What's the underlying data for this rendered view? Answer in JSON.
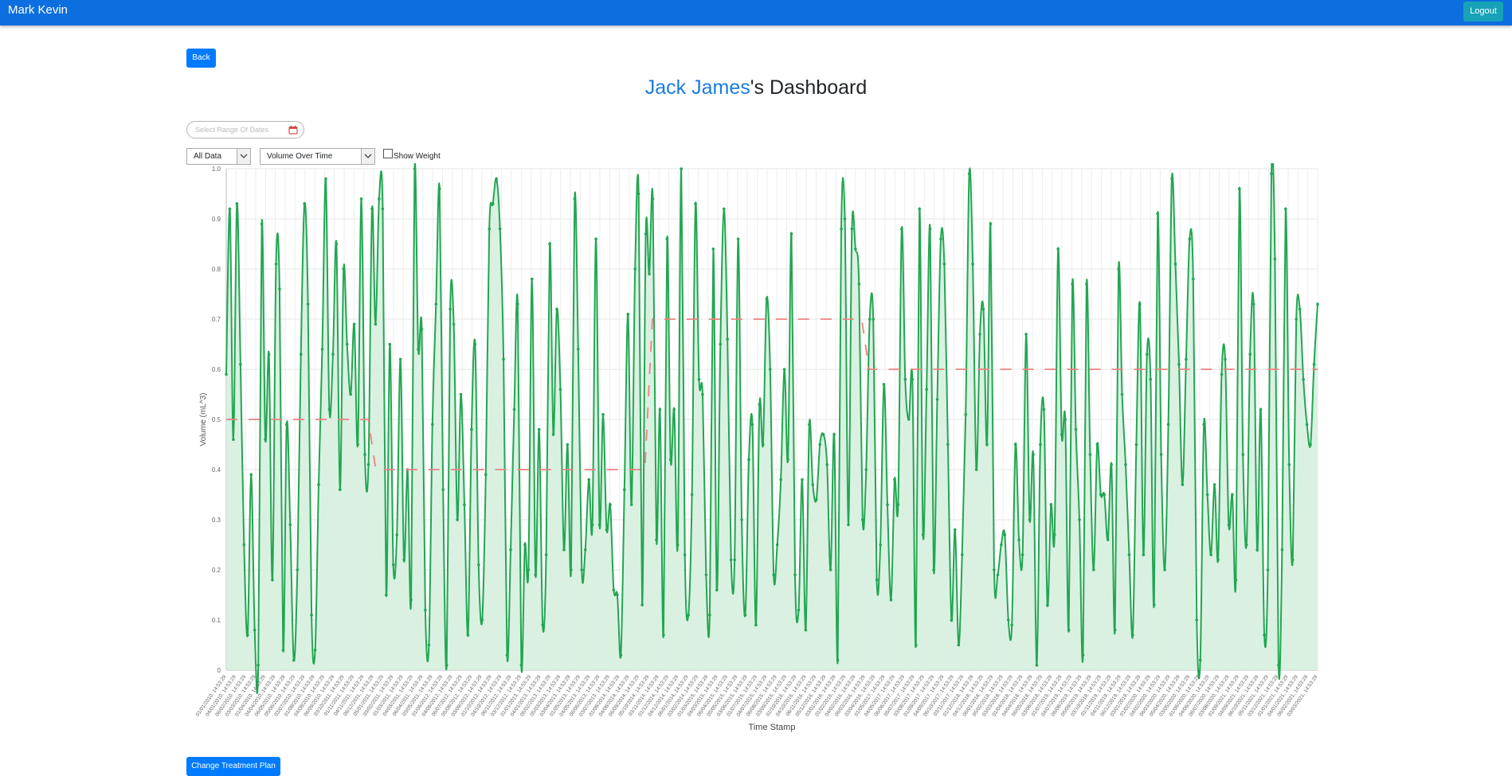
{
  "navbar": {
    "brand": "Mark Kevin",
    "logout_label": "Logout"
  },
  "back_label": "Back",
  "title": {
    "patient_name": "Jack James",
    "suffix": "'s Dashboard"
  },
  "date_range": {
    "placeholder": "Select Range Of Dates"
  },
  "filters": {
    "data_select": "All Data",
    "metric_select": "Volume Over Time",
    "show_weight_label": "Show Weight",
    "show_weight_checked": false
  },
  "change_plan_label": "Change Treatment Plan",
  "colors": {
    "navbar": "#0d6edf",
    "line": "#22a652",
    "fill": "#d6f0df",
    "target": "#f08080",
    "button": "#007bff"
  },
  "icons": {
    "calendar": "calendar-icon",
    "dropdown": "chevron-down-icon"
  },
  "chart_data": {
    "type": "area",
    "xlabel": "Time Stamp",
    "ylabel": "Volume (mL^3)",
    "ylim": [
      0,
      1
    ],
    "yticks": [
      "0",
      "0.1",
      "0.2",
      "0.3",
      "0.4",
      "0.5",
      "0.6",
      "0.7",
      "0.8",
      "0.9",
      "1.0"
    ],
    "grid": true,
    "x": [
      "01/01/2010, 14:53:29",
      "04/01/2010, 14:53:29",
      "06/02/2010, 14:53:29",
      "03/03/2010, 14:53:29",
      "01/04/2010, 14:53:29",
      "04/04/2010, 14:53:29",
      "06/05/2010, 14:53:29",
      "05/06/2010, 14:53:29",
      "03/07/2010, 14:53:29",
      "01/08/2010, 14:53:29",
      "04/08/2010, 14:53:29",
      "06/09/2010, 14:53:29",
      "03/10/2011, 14:53:29",
      "01/11/2011, 14:53:29",
      "04/11/2011, 14:53:29",
      "06/12/2011, 14:53:29",
      "05/01/2011, 14:53:29",
      "03/02/2011, 14:53:29",
      "01/03/2011, 14:53:29",
      "04/03/2011, 14:53:29",
      "06/04/2011, 14:53:29",
      "03/05/2011, 14:53:29",
      "01/06/2012, 14:53:29",
      "04/06/2012, 14:53:29",
      "06/07/2012, 14:53:29",
      "05/08/2012, 14:53:29",
      "03/09/2012, 14:53:29",
      "01/10/2012, 14:53:29",
      "04/10/2012, 14:53:29",
      "06/11/2012, 14:53:29",
      "03/12/2012, 14:53:29",
      "01/01/2013, 14:53:29",
      "04/01/2013, 14:53:29",
      "06/02/2013, 14:53:29",
      "05/03/2013, 14:53:29",
      "03/04/2013, 14:53:29",
      "01/05/2013, 14:53:29",
      "04/05/2013, 14:53:29",
      "06/06/2013, 14:53:29",
      "03/07/2013, 14:53:29",
      "01/08/2014, 14:53:29",
      "04/08/2014, 14:53:29",
      "06/09/2014, 14:53:29",
      "05/10/2014, 14:53:29",
      "03/11/2014, 14:53:29",
      "01/12/2014, 14:53:29",
      "04/12/2014, 14:53:29",
      "06/01/2014, 14:53:29",
      "03/02/2014, 14:53:29",
      "01/03/2015, 14:53:29",
      "04/03/2015, 14:53:29",
      "06/04/2015, 14:53:29",
      "05/05/2015, 14:53:29",
      "03/06/2015, 14:53:29",
      "01/07/2015, 14:53:29",
      "04/07/2015, 14:53:29",
      "06/08/2015, 14:53:29",
      "03/09/2015, 14:53:29",
      "01/10/2016, 14:53:29",
      "04/10/2016, 14:53:29",
      "06/11/2016, 14:53:29",
      "05/12/2016, 14:53:29",
      "03/01/2016, 14:53:29",
      "01/02/2016, 14:53:29",
      "04/02/2016, 14:53:29",
      "06/03/2016, 14:53:29",
      "03/04/2016, 14:53:29",
      "01/05/2017, 14:53:29",
      "04/05/2017, 14:53:29",
      "06/06/2017, 14:53:29",
      "05/07/2017, 14:53:29",
      "03/08/2017, 14:53:29",
      "01/09/2017, 14:53:29",
      "04/09/2017, 14:53:29",
      "06/10/2017, 14:53:29",
      "03/11/2017, 14:53:29",
      "01/12/2018, 14:53:29",
      "04/12/2018, 14:53:29",
      "06/01/2018, 14:53:29",
      "05/02/2018, 14:53:29",
      "03/03/2018, 14:53:29",
      "01/04/2018, 14:53:29",
      "04/04/2018, 14:53:29",
      "06/05/2018, 14:53:29",
      "03/06/2018, 14:53:29",
      "01/07/2019, 14:53:29",
      "04/07/2019, 14:53:29",
      "06/08/2019, 14:53:29",
      "05/09/2019, 14:53:29",
      "03/10/2019, 14:53:29",
      "01/11/2019, 14:53:29",
      "04/11/2019, 14:53:29",
      "06/12/2019, 14:53:29",
      "03/01/2019, 14:53:29",
      "01/02/2020, 14:53:29",
      "04/02/2020, 14:53:29",
      "06/03/2020, 14:53:29",
      "05/04/2020, 14:53:29",
      "03/05/2020, 14:53:29",
      "01/06/2020, 14:53:29",
      "04/06/2020, 14:53:29",
      "06/07/2020, 14:53:29",
      "03/08/2020, 14:53:29",
      "01/09/2021, 14:53:29",
      "04/09/2021, 14:53:29",
      "06/10/2021, 14:53:29",
      "05/11/2021, 14:53:29",
      "03/12/2021, 14:53:29",
      "01/01/2021, 14:53:29",
      "04/01/2021, 14:53:29",
      "06/02/2021, 14:53:29",
      "03/03/2021, 14:53:29"
    ],
    "series": [
      {
        "values": [
          0.59,
          0.92,
          0.46,
          0.93,
          0.61,
          0.25,
          0.07,
          0.39,
          0.08,
          0.01,
          0.89,
          0.46,
          0.63,
          0.18,
          0.81,
          0.76,
          0.04,
          0.49,
          0.29,
          0.02,
          0.2,
          0.63,
          0.93,
          0.73,
          0.11,
          0.04,
          0.37,
          0.64,
          0.98,
          0.52,
          0.63,
          0.85,
          0.36,
          0.8,
          0.65,
          0.55,
          0.69,
          0.45,
          0.94,
          0.43,
          0.41,
          0.92,
          0.69,
          0.94,
          0.92,
          0.15,
          0.65,
          0.21,
          0.27,
          0.62,
          0.22,
          0.4,
          0.14,
          1.0,
          0.64,
          0.68,
          0.12,
          0.05,
          0.49,
          0.73,
          0.96,
          0.36,
          0.01,
          0.72,
          0.69,
          0.3,
          0.55,
          0.33,
          0.07,
          0.48,
          0.65,
          0.21,
          0.1,
          0.39,
          0.88,
          0.93,
          0.98,
          0.88,
          0.62,
          0.03,
          0.24,
          0.52,
          0.73,
          0.01,
          0.25,
          0.2,
          0.78,
          0.19,
          0.48,
          0.09,
          0.23,
          0.85,
          0.47,
          0.72,
          0.56,
          0.24,
          0.45,
          0.2,
          0.94,
          0.64,
          0.2,
          0.24,
          0.38,
          0.29,
          0.86,
          0.29,
          0.51,
          0.28,
          0.33,
          0.16,
          0.15,
          0.03,
          0.36,
          0.71,
          0.33,
          0.8,
          0.95,
          0.13,
          0.87,
          0.79,
          0.94,
          0.26,
          0.52,
          0.07,
          0.86,
          0.42,
          0.52,
          0.25,
          1.0,
          0.23,
          0.11,
          0.35,
          0.93,
          0.58,
          0.55,
          0.19,
          0.11,
          0.84,
          0.16,
          0.65,
          0.92,
          0.66,
          0.22,
          0.22,
          0.86,
          0.3,
          0.11,
          0.42,
          0.49,
          0.09,
          0.53,
          0.45,
          0.74,
          0.6,
          0.19,
          0.25,
          0.38,
          0.6,
          0.42,
          0.87,
          0.19,
          0.12,
          0.38,
          0.08,
          0.49,
          0.37,
          0.34,
          0.45,
          0.47,
          0.41,
          0.2,
          0.47,
          0.02,
          0.88,
          0.9,
          0.29,
          0.88,
          0.84,
          0.77,
          0.3,
          0.4,
          0.7,
          0.7,
          0.18,
          0.25,
          0.57,
          0.33,
          0.14,
          0.38,
          0.33,
          0.88,
          0.58,
          0.5,
          0.58,
          0.05,
          0.92,
          0.27,
          0.56,
          0.88,
          0.2,
          0.54,
          0.86,
          0.81,
          0.45,
          0.1,
          0.28,
          0.05,
          0.23,
          0.51,
          0.99,
          0.81,
          0.4,
          0.67,
          0.72,
          0.45,
          0.89,
          0.2,
          0.19,
          0.25,
          0.27,
          0.1,
          0.09,
          0.45,
          0.26,
          0.23,
          0.67,
          0.3,
          0.43,
          0.01,
          0.45,
          0.52,
          0.13,
          0.33,
          0.27,
          0.84,
          0.47,
          0.5,
          0.08,
          0.77,
          0.48,
          0.3,
          0.03,
          0.77,
          0.43,
          0.2,
          0.45,
          0.35,
          0.35,
          0.26,
          0.41,
          0.08,
          0.8,
          0.55,
          0.41,
          0.23,
          0.07,
          0.45,
          0.73,
          0.23,
          0.63,
          0.58,
          0.13,
          0.91,
          0.43,
          0.2,
          0.49,
          0.98,
          0.81,
          0.61,
          0.37,
          0.62,
          0.86,
          0.78,
          0.1,
          0.02,
          0.49,
          0.35,
          0.23,
          0.37,
          0.22,
          0.59,
          0.62,
          0.29,
          0.35,
          0.18,
          0.96,
          0.43,
          0.25,
          0.63,
          0.73,
          0.24,
          0.52,
          0.07,
          0.2,
          0.99,
          0.82,
          0.01,
          0.24,
          0.92,
          0.41,
          0.22,
          0.7,
          0.72,
          0.58,
          0.49,
          0.45,
          0.61,
          0.73
        ]
      },
      {
        "values": [
          0.5,
          0.5,
          0.5,
          0.5,
          0.5,
          0.5,
          0.5,
          0.5,
          0.5,
          0.5,
          0.5,
          0.5,
          0.5,
          0.5,
          0.5,
          0.5,
          0.5,
          0.5,
          0.5,
          0.5,
          0.4,
          0.4,
          0.4,
          0.4,
          0.4,
          0.4,
          0.4,
          0.4,
          0.4,
          0.4,
          0.4,
          0.4,
          0.4,
          0.4,
          0.4,
          0.4,
          0.4,
          0.4,
          0.4,
          0.4,
          0.4,
          0.4,
          0.4,
          0.4,
          0.4,
          0.4,
          0.4,
          0.4,
          0.4,
          0.4,
          0.4,
          0.4,
          0.4,
          0.4,
          0.4,
          0.4,
          0.4,
          0.7,
          0.7,
          0.7,
          0.7,
          0.7,
          0.7,
          0.7,
          0.7,
          0.7,
          0.7,
          0.7,
          0.7,
          0.7,
          0.7,
          0.7,
          0.7,
          0.7,
          0.7,
          0.7,
          0.7,
          0.7,
          0.7,
          0.7,
          0.7,
          0.7,
          0.7,
          0.7,
          0.7,
          0.7,
          0.6,
          0.6,
          0.6,
          0.6,
          0.6,
          0.6,
          0.6,
          0.6,
          0.6,
          0.6,
          0.6,
          0.6,
          0.6,
          0.6,
          0.6,
          0.6,
          0.6,
          0.6,
          0.6,
          0.6,
          0.6,
          0.6,
          0.6,
          0.6,
          0.6,
          0.6,
          0.6,
          0.6,
          0.6,
          0.6,
          0.6,
          0.6,
          0.6,
          0.6,
          0.6,
          0.6,
          0.6,
          0.6,
          0.6,
          0.6,
          0.6,
          0.6,
          0.6,
          0.6,
          0.6,
          0.6,
          0.6,
          0.6,
          0.6,
          0.6,
          0.6,
          0.6,
          0.6,
          0.6,
          0.6,
          0.6,
          0.6,
          0.6,
          0.6,
          0.6,
          0.6
        ]
      }
    ]
  }
}
